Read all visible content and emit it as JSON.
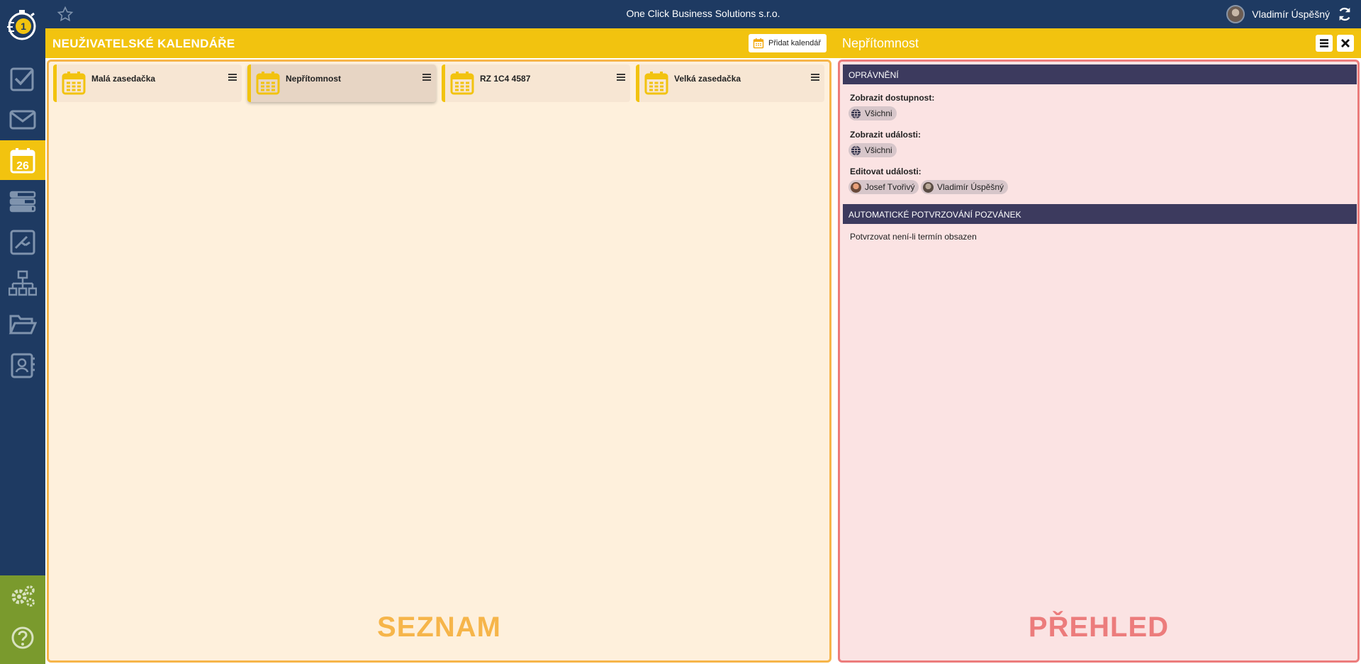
{
  "topbar": {
    "company": "One Click Business Solutions s.r.o.",
    "user_name": "Vladimír Úspěšný"
  },
  "sidebar": {
    "items": [
      {
        "icon": "check-icon"
      },
      {
        "icon": "mail-icon"
      },
      {
        "icon": "calendar-icon",
        "label": "26",
        "active": true
      },
      {
        "icon": "list-icon"
      },
      {
        "icon": "workflow-icon"
      },
      {
        "icon": "org-chart-icon"
      },
      {
        "icon": "folder-icon"
      },
      {
        "icon": "contacts-icon"
      }
    ],
    "bottom": [
      {
        "icon": "settings-icon"
      },
      {
        "icon": "help-icon"
      }
    ]
  },
  "left_panel": {
    "title": "NEUŽIVATELSKÉ KALENDÁŘE",
    "add_button": "Přidat kalendář",
    "cards": [
      {
        "name": "Malá zasedačka",
        "selected": false
      },
      {
        "name": "Nepřítomnost",
        "selected": true
      },
      {
        "name": "RZ 1C4 4587",
        "selected": false
      },
      {
        "name": "Velká zasedačka",
        "selected": false
      }
    ],
    "watermark": "SEZNAM"
  },
  "right_panel": {
    "title": "Nepřítomnost",
    "sections": {
      "permissions": "OPRÁVNĚNÍ",
      "auto_confirm": "AUTOMATICKÉ POTVRZOVÁNÍ POZVÁNEK"
    },
    "show_availability_label": "Zobrazit dostupnost:",
    "show_availability_value": "Všichni",
    "show_events_label": "Zobrazit události:",
    "show_events_value": "Všichni",
    "edit_events_label": "Editovat události:",
    "editors": [
      "Josef Tvořivý",
      "Vladimír Úspěšný"
    ],
    "auto_confirm_text": "Potvrzovat není-li termín obsazen",
    "watermark": "PŘEHLED"
  },
  "colors": {
    "navy": "#1e3a62",
    "yellow": "#f2c30f",
    "green": "#7a9a2d",
    "list_border": "#f6b54a",
    "detail_border": "#ec7c7c",
    "section_header": "#3c3a5e"
  }
}
